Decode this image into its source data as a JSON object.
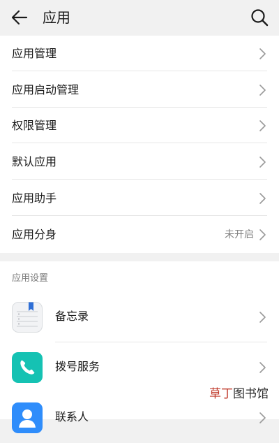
{
  "header": {
    "title": "应用",
    "back_icon": "arrow-left-icon",
    "search_icon": "search-icon"
  },
  "menu": {
    "items": [
      {
        "label": "应用管理",
        "value": ""
      },
      {
        "label": "应用启动管理",
        "value": ""
      },
      {
        "label": "权限管理",
        "value": ""
      },
      {
        "label": "默认应用",
        "value": ""
      },
      {
        "label": "应用助手",
        "value": ""
      },
      {
        "label": "应用分身",
        "value": "未开启"
      }
    ]
  },
  "app_settings": {
    "section_title": "应用设置",
    "items": [
      {
        "label": "备忘录",
        "icon": "notepad-icon",
        "color": "#f2f3f5"
      },
      {
        "label": "拨号服务",
        "icon": "phone-icon",
        "color": "#15c2b3"
      },
      {
        "label": "联系人",
        "icon": "contacts-icon",
        "color": "#2f8dfb"
      }
    ]
  },
  "watermark": {
    "part1": "草丁",
    "part2": "图书馆"
  },
  "colors": {
    "background": "#f1f1f1",
    "card": "#ffffff",
    "divider": "#e6e6e6",
    "secondary_text": "#808080"
  }
}
